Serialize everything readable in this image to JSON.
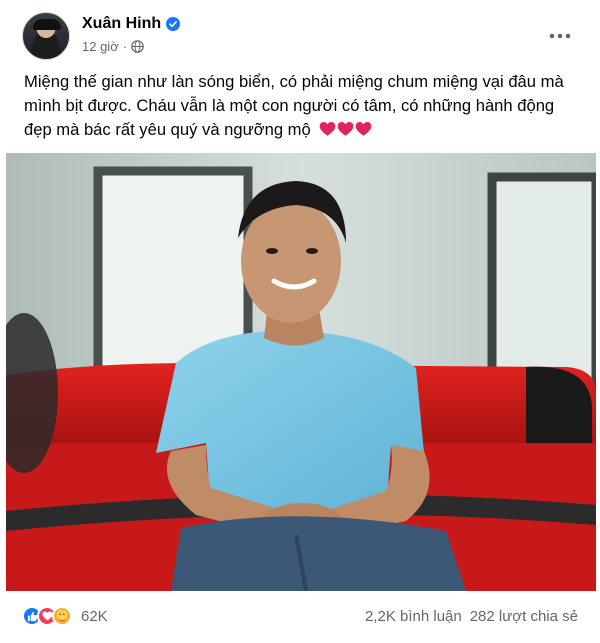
{
  "post": {
    "author": "Xuân Hinh",
    "time": "12 giờ",
    "dot": "·",
    "text": "Miệng thế gian như làn sóng biển, có phải miệng chum miệng vại đâu mà mình bịt được. Cháu vẫn là một con người có tâm, có những hành động đẹp mà bác rất yêu quý và ngưỡng mộ",
    "icons": {
      "verified": "verified-badge-icon",
      "privacy": "globe-icon",
      "more": "more-options-icon",
      "hearts": [
        "heart-icon",
        "heart-icon",
        "heart-icon"
      ]
    }
  },
  "footer": {
    "reaction_count": "62K",
    "comments": "2,2K bình luận",
    "shares": "282 lượt chia sẻ",
    "reaction_icons": [
      "like-icon",
      "love-icon",
      "care-icon"
    ]
  },
  "colors": {
    "accent": "#1877f2",
    "heart": "#e0245e",
    "secondary_text": "#65676b"
  }
}
